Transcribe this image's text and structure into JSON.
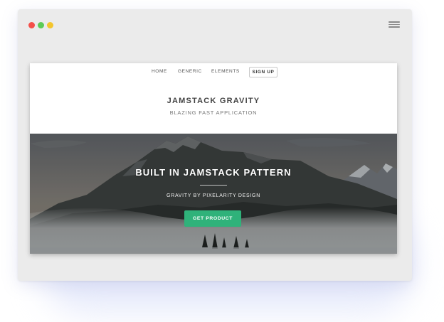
{
  "window": {
    "traffic_lights": [
      "close",
      "minimize",
      "maximize"
    ],
    "menu_icon": "hamburger-menu-icon"
  },
  "nav": {
    "links": [
      "HOME",
      "GENERIC",
      "ELEMENTS"
    ],
    "signup_label": "SIGN UP"
  },
  "site": {
    "title": "JAMSTACK GRAVITY",
    "tagline": "BLAZING FAST APPLICATION"
  },
  "hero": {
    "heading": "BUILT IN JAMSTACK PATTERN",
    "subheading": "GRAVITY BY PIXELARITY DESIGN",
    "cta_label": "GET PRODUCT",
    "background": "mountain-landscape-image"
  },
  "colors": {
    "accent": "#2fb27a",
    "traffic_red": "#f4504a",
    "traffic_green": "#5ccb56",
    "traffic_yellow": "#f3c52d",
    "frame": "#ebebeb"
  }
}
